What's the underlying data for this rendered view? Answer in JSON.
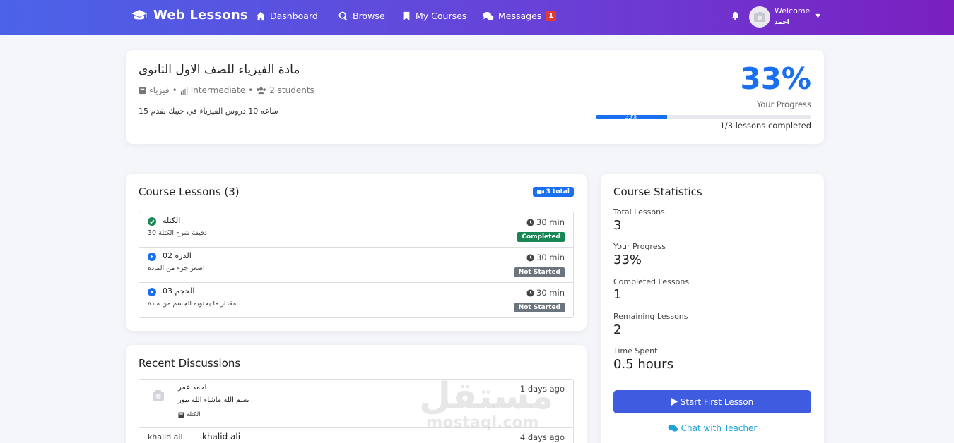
{
  "nav": {
    "brand": "Web Lessons",
    "items": [
      {
        "label": "Dashboard",
        "icon": "home-icon"
      },
      {
        "label": "Browse",
        "icon": "search-icon"
      },
      {
        "label": "My Courses",
        "icon": "bookmark-icon"
      },
      {
        "label": "Messages",
        "icon": "comments-icon",
        "badge": "1"
      }
    ],
    "welcome": "Welcome",
    "user_name": "احمد"
  },
  "course": {
    "title": "مادة الفيزياء للصف الاول الثانوى",
    "category": "فيزياء",
    "level": "Intermediate",
    "students": "2 students",
    "description": "ساعه 10 دروس الفيزياء في جيبك بفدم 15",
    "progress_percent": "33%",
    "progress_value": 33,
    "progress_label": "Your Progress",
    "progress_bar_text": "33%",
    "lessons_completed": "1/3 lessons completed"
  },
  "lessons": {
    "title": "Course Lessons (3)",
    "total_badge": "3 total",
    "items": [
      {
        "name": "الكتله",
        "desc": "دقيقة شرح الكتلة 30",
        "duration": "30 min",
        "status": "Completed",
        "done": true
      },
      {
        "name": "الذره 02",
        "desc": "اصغر جزء من المادة",
        "duration": "30 min",
        "status": "Not Started",
        "done": false
      },
      {
        "name": "الحجم 03",
        "desc": "مقدار ما يحتويه الجسم من مادة",
        "duration": "30 min",
        "status": "Not Started",
        "done": false
      }
    ]
  },
  "stats": {
    "title": "Course Statistics",
    "items": [
      {
        "label": "Total Lessons",
        "value": "3"
      },
      {
        "label": "Your Progress",
        "value": "33%"
      },
      {
        "label": "Completed Lessons",
        "value": "1"
      },
      {
        "label": "Remaining Lessons",
        "value": "2"
      },
      {
        "label": "Time Spent",
        "value": "0.5 hours"
      }
    ],
    "start_button": "Start First Lesson",
    "chat_link": "Chat with Teacher"
  },
  "discussions": {
    "title": "Recent Discussions",
    "items": [
      {
        "author": "احمد عمر",
        "text": "بسم الله ماشاء الله بنور",
        "lesson": "الكتلة",
        "time": "1 days ago"
      },
      {
        "avatar_alt": "khalid ali",
        "author": "khalid ali",
        "time": "4 days ago"
      }
    ]
  },
  "watermark": {
    "ar": "مستقل",
    "en": "mostaql.com"
  },
  "colors": {
    "accent": "#1a6ff0",
    "success": "#198754",
    "muted": "#6c757d",
    "button": "#3f5be0",
    "link": "#1fa2d8",
    "badge": "#e53935"
  }
}
